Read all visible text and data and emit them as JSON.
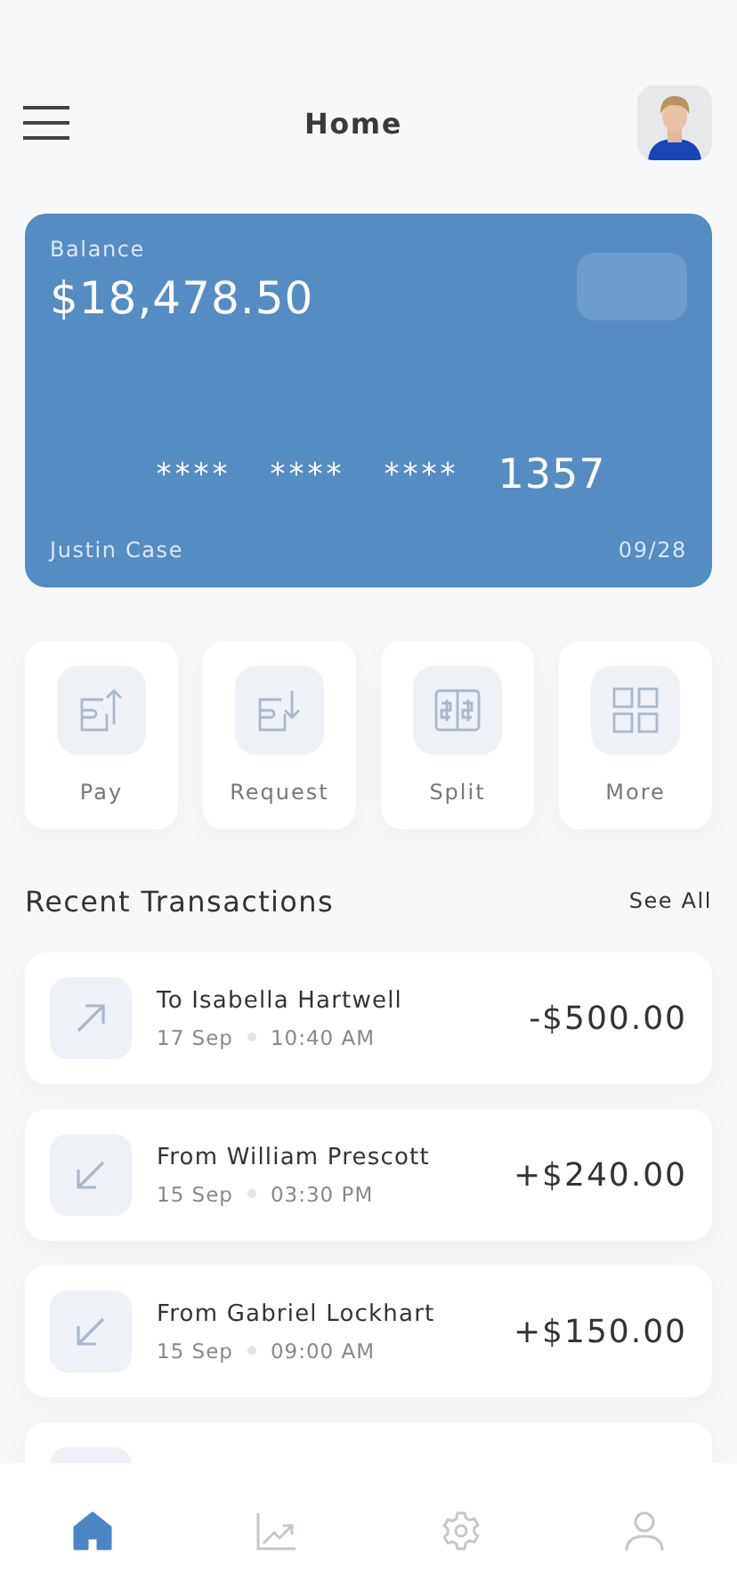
{
  "header": {
    "title": "Home"
  },
  "card": {
    "label": "Balance",
    "balance": "$18,478.50",
    "number_groups": [
      "****",
      "****",
      "****",
      "1357"
    ],
    "holder": "Justin Case",
    "expiry": "09/28"
  },
  "actions": [
    {
      "kind": "pay",
      "label": "Pay"
    },
    {
      "kind": "request",
      "label": "Request"
    },
    {
      "kind": "split",
      "label": "Split"
    },
    {
      "kind": "more",
      "label": "More"
    }
  ],
  "section": {
    "title": "Recent Transactions",
    "link": "See All"
  },
  "transactions": [
    {
      "kind": "out",
      "name": "To Isabella Hartwell",
      "date": "17 Sep",
      "time": "10:40 AM",
      "amount": "-$500.00"
    },
    {
      "kind": "in",
      "name": "From William Prescott",
      "date": "15 Sep",
      "time": "03:30 PM",
      "amount": "+$240.00"
    },
    {
      "kind": "in",
      "name": "From Gabriel Lockhart",
      "date": "15 Sep",
      "time": "09:00 AM",
      "amount": "+$150.00"
    }
  ],
  "nav": [
    {
      "kind": "home",
      "selected": true
    },
    {
      "kind": "chart",
      "selected": false
    },
    {
      "kind": "settings",
      "selected": false
    },
    {
      "kind": "profile",
      "selected": false
    }
  ]
}
